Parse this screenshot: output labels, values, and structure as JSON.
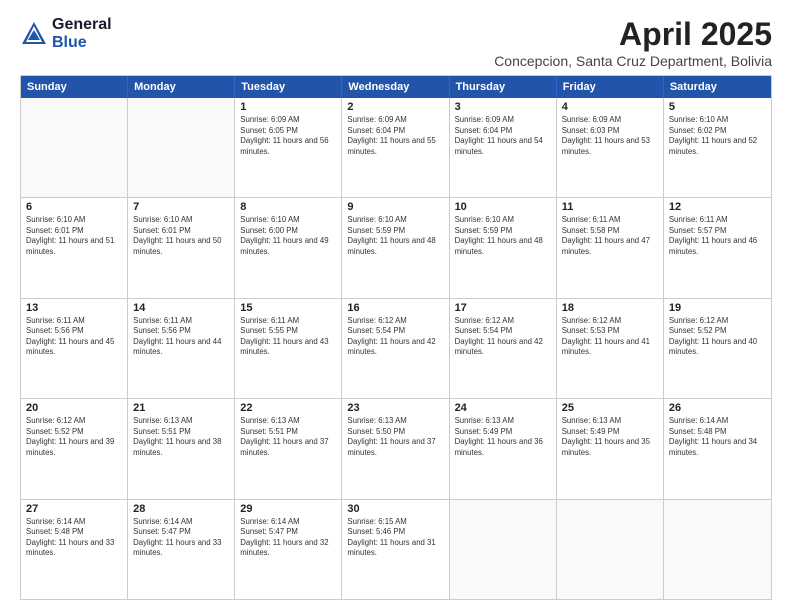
{
  "logo": {
    "general": "General",
    "blue": "Blue"
  },
  "title": "April 2025",
  "location": "Concepcion, Santa Cruz Department, Bolivia",
  "days_of_week": [
    "Sunday",
    "Monday",
    "Tuesday",
    "Wednesday",
    "Thursday",
    "Friday",
    "Saturday"
  ],
  "weeks": [
    [
      {
        "day": "",
        "sunrise": "",
        "sunset": "",
        "daylight": ""
      },
      {
        "day": "",
        "sunrise": "",
        "sunset": "",
        "daylight": ""
      },
      {
        "day": "1",
        "sunrise": "Sunrise: 6:09 AM",
        "sunset": "Sunset: 6:05 PM",
        "daylight": "Daylight: 11 hours and 56 minutes."
      },
      {
        "day": "2",
        "sunrise": "Sunrise: 6:09 AM",
        "sunset": "Sunset: 6:04 PM",
        "daylight": "Daylight: 11 hours and 55 minutes."
      },
      {
        "day": "3",
        "sunrise": "Sunrise: 6:09 AM",
        "sunset": "Sunset: 6:04 PM",
        "daylight": "Daylight: 11 hours and 54 minutes."
      },
      {
        "day": "4",
        "sunrise": "Sunrise: 6:09 AM",
        "sunset": "Sunset: 6:03 PM",
        "daylight": "Daylight: 11 hours and 53 minutes."
      },
      {
        "day": "5",
        "sunrise": "Sunrise: 6:10 AM",
        "sunset": "Sunset: 6:02 PM",
        "daylight": "Daylight: 11 hours and 52 minutes."
      }
    ],
    [
      {
        "day": "6",
        "sunrise": "Sunrise: 6:10 AM",
        "sunset": "Sunset: 6:01 PM",
        "daylight": "Daylight: 11 hours and 51 minutes."
      },
      {
        "day": "7",
        "sunrise": "Sunrise: 6:10 AM",
        "sunset": "Sunset: 6:01 PM",
        "daylight": "Daylight: 11 hours and 50 minutes."
      },
      {
        "day": "8",
        "sunrise": "Sunrise: 6:10 AM",
        "sunset": "Sunset: 6:00 PM",
        "daylight": "Daylight: 11 hours and 49 minutes."
      },
      {
        "day": "9",
        "sunrise": "Sunrise: 6:10 AM",
        "sunset": "Sunset: 5:59 PM",
        "daylight": "Daylight: 11 hours and 48 minutes."
      },
      {
        "day": "10",
        "sunrise": "Sunrise: 6:10 AM",
        "sunset": "Sunset: 5:59 PM",
        "daylight": "Daylight: 11 hours and 48 minutes."
      },
      {
        "day": "11",
        "sunrise": "Sunrise: 6:11 AM",
        "sunset": "Sunset: 5:58 PM",
        "daylight": "Daylight: 11 hours and 47 minutes."
      },
      {
        "day": "12",
        "sunrise": "Sunrise: 6:11 AM",
        "sunset": "Sunset: 5:57 PM",
        "daylight": "Daylight: 11 hours and 46 minutes."
      }
    ],
    [
      {
        "day": "13",
        "sunrise": "Sunrise: 6:11 AM",
        "sunset": "Sunset: 5:56 PM",
        "daylight": "Daylight: 11 hours and 45 minutes."
      },
      {
        "day": "14",
        "sunrise": "Sunrise: 6:11 AM",
        "sunset": "Sunset: 5:56 PM",
        "daylight": "Daylight: 11 hours and 44 minutes."
      },
      {
        "day": "15",
        "sunrise": "Sunrise: 6:11 AM",
        "sunset": "Sunset: 5:55 PM",
        "daylight": "Daylight: 11 hours and 43 minutes."
      },
      {
        "day": "16",
        "sunrise": "Sunrise: 6:12 AM",
        "sunset": "Sunset: 5:54 PM",
        "daylight": "Daylight: 11 hours and 42 minutes."
      },
      {
        "day": "17",
        "sunrise": "Sunrise: 6:12 AM",
        "sunset": "Sunset: 5:54 PM",
        "daylight": "Daylight: 11 hours and 42 minutes."
      },
      {
        "day": "18",
        "sunrise": "Sunrise: 6:12 AM",
        "sunset": "Sunset: 5:53 PM",
        "daylight": "Daylight: 11 hours and 41 minutes."
      },
      {
        "day": "19",
        "sunrise": "Sunrise: 6:12 AM",
        "sunset": "Sunset: 5:52 PM",
        "daylight": "Daylight: 11 hours and 40 minutes."
      }
    ],
    [
      {
        "day": "20",
        "sunrise": "Sunrise: 6:12 AM",
        "sunset": "Sunset: 5:52 PM",
        "daylight": "Daylight: 11 hours and 39 minutes."
      },
      {
        "day": "21",
        "sunrise": "Sunrise: 6:13 AM",
        "sunset": "Sunset: 5:51 PM",
        "daylight": "Daylight: 11 hours and 38 minutes."
      },
      {
        "day": "22",
        "sunrise": "Sunrise: 6:13 AM",
        "sunset": "Sunset: 5:51 PM",
        "daylight": "Daylight: 11 hours and 37 minutes."
      },
      {
        "day": "23",
        "sunrise": "Sunrise: 6:13 AM",
        "sunset": "Sunset: 5:50 PM",
        "daylight": "Daylight: 11 hours and 37 minutes."
      },
      {
        "day": "24",
        "sunrise": "Sunrise: 6:13 AM",
        "sunset": "Sunset: 5:49 PM",
        "daylight": "Daylight: 11 hours and 36 minutes."
      },
      {
        "day": "25",
        "sunrise": "Sunrise: 6:13 AM",
        "sunset": "Sunset: 5:49 PM",
        "daylight": "Daylight: 11 hours and 35 minutes."
      },
      {
        "day": "26",
        "sunrise": "Sunrise: 6:14 AM",
        "sunset": "Sunset: 5:48 PM",
        "daylight": "Daylight: 11 hours and 34 minutes."
      }
    ],
    [
      {
        "day": "27",
        "sunrise": "Sunrise: 6:14 AM",
        "sunset": "Sunset: 5:48 PM",
        "daylight": "Daylight: 11 hours and 33 minutes."
      },
      {
        "day": "28",
        "sunrise": "Sunrise: 6:14 AM",
        "sunset": "Sunset: 5:47 PM",
        "daylight": "Daylight: 11 hours and 33 minutes."
      },
      {
        "day": "29",
        "sunrise": "Sunrise: 6:14 AM",
        "sunset": "Sunset: 5:47 PM",
        "daylight": "Daylight: 11 hours and 32 minutes."
      },
      {
        "day": "30",
        "sunrise": "Sunrise: 6:15 AM",
        "sunset": "Sunset: 5:46 PM",
        "daylight": "Daylight: 11 hours and 31 minutes."
      },
      {
        "day": "",
        "sunrise": "",
        "sunset": "",
        "daylight": ""
      },
      {
        "day": "",
        "sunrise": "",
        "sunset": "",
        "daylight": ""
      },
      {
        "day": "",
        "sunrise": "",
        "sunset": "",
        "daylight": ""
      }
    ]
  ]
}
